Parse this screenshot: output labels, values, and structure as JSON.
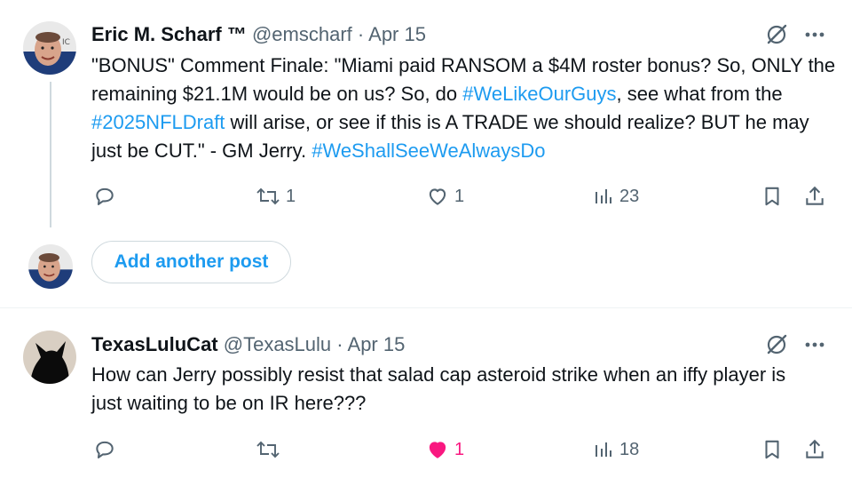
{
  "tweet1": {
    "display_name": "Eric M. Scharf ™",
    "handle": "@emscharf",
    "separator": "·",
    "date": "Apr 15",
    "text_parts": {
      "p1": "\"BONUS\" Comment Finale: \"Miami paid RANSOM a $4M roster bonus? So, ONLY the remaining $21.1M would be on us? So, do ",
      "tag1": "#WeLikeOurGuys",
      "p2": ", see what from the ",
      "tag2": "#2025NFLDraft",
      "p3": " will arise, or see if this is A TRADE we should realize? BUT he may just be CUT.\" - GM Jerry. ",
      "tag3": "#WeShallSeeWeAlwaysDo"
    },
    "reply_count": "",
    "repost_count": "1",
    "like_count": "1",
    "view_count": "23"
  },
  "add_post": {
    "label": "Add another post"
  },
  "tweet2": {
    "display_name": "TexasLuluCat",
    "handle": "@TexasLulu",
    "separator": "·",
    "date": "Apr 15",
    "text": "How can Jerry possibly resist that salad cap asteroid strike when an iffy player is just waiting to be on IR here???",
    "reply_count": "",
    "repost_count": "",
    "like_count": "1",
    "view_count": "18",
    "liked": true
  },
  "icons": {
    "grok": "grok-slash-icon",
    "more": "more-dots-icon",
    "reply": "reply-bubble-icon",
    "repost": "repost-arrows-icon",
    "like": "heart-icon",
    "views": "views-bars-icon",
    "bookmark": "bookmark-icon",
    "share": "share-upload-icon"
  },
  "colors": {
    "link": "#1d9bf0",
    "muted": "#536471",
    "like_active": "#f91880",
    "border": "#cfd9de"
  }
}
